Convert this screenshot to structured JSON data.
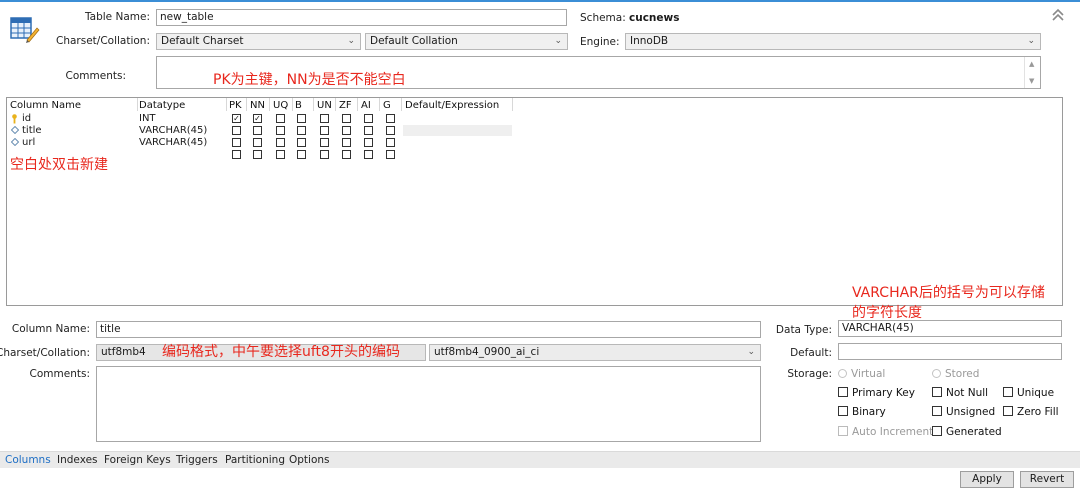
{
  "table": {
    "name_label": "Table Name:",
    "name_value": "new_table",
    "schema_label": "Schema:",
    "schema_value": "cucnews",
    "charset_label": "Charset/Collation:",
    "charset_value": "Default Charset",
    "collation_value": "Default Collation",
    "engine_label": "Engine:",
    "engine_value": "InnoDB",
    "comments_label": "Comments:"
  },
  "grid": {
    "headers": {
      "name": "Column Name",
      "datatype": "Datatype",
      "pk": "PK",
      "nn": "NN",
      "uq": "UQ",
      "b": "B",
      "un": "UN",
      "zf": "ZF",
      "ai": "AI",
      "g": "G",
      "default": "Default/Expression"
    },
    "rows": [
      {
        "name": "id",
        "type": "INT",
        "icon": "primary-key-icon",
        "flags": [
          true,
          true,
          false,
          false,
          false,
          false,
          false,
          false
        ]
      },
      {
        "name": "title",
        "type": "VARCHAR(45)",
        "icon": "column-diamond-icon",
        "flags": [
          false,
          false,
          false,
          false,
          false,
          false,
          false,
          false
        ]
      },
      {
        "name": "url",
        "type": "VARCHAR(45)",
        "icon": "column-diamond-icon",
        "flags": [
          false,
          false,
          false,
          false,
          false,
          false,
          false,
          false
        ]
      },
      {
        "name": "",
        "type": "",
        "icon": "",
        "flags": [
          false,
          false,
          false,
          false,
          false,
          false,
          false,
          false
        ]
      }
    ]
  },
  "annotations": {
    "pk_nn": "PK为主键，NN为是否不能空白",
    "blank": "空白处双击新建",
    "varchar_line1": "VARCHAR后的括号为可以存储",
    "varchar_line2": "的字符长度",
    "encoding": "编码格式，中午要选择uft8开头的编码"
  },
  "column": {
    "name_label": "Column Name:",
    "name_value": "title",
    "charset_label": "Charset/Collation:",
    "charset_value": "utf8mb4",
    "collation_value": "utf8mb4_0900_ai_ci",
    "comments_label": "Comments:",
    "datatype_label": "Data Type:",
    "datatype_value": "VARCHAR(45)",
    "default_label": "Default:",
    "default_value": "",
    "storage_label": "Storage:",
    "virtual": "Virtual",
    "stored": "Stored",
    "primary_key": "Primary Key",
    "not_null": "Not Null",
    "unique": "Unique",
    "binary": "Binary",
    "unsigned": "Unsigned",
    "zero_fill": "Zero Fill",
    "auto_increment": "Auto Increment",
    "generated": "Generated"
  },
  "tabs": [
    "Columns",
    "Indexes",
    "Foreign Keys",
    "Triggers",
    "Partitioning",
    "Options"
  ],
  "buttons": {
    "apply": "Apply",
    "revert": "Revert"
  },
  "colors": {
    "annotation": "#e8281e",
    "active_tab": "#1f6fc5",
    "accent_top": "#3b8ed6"
  }
}
